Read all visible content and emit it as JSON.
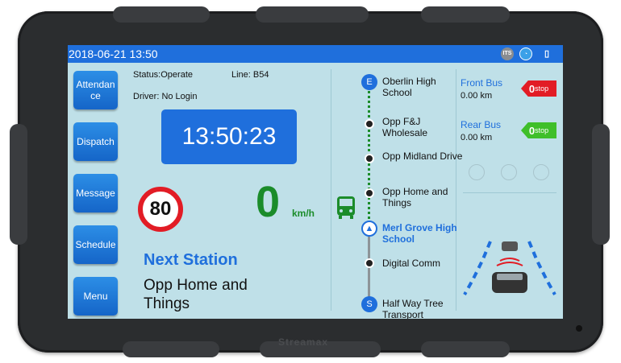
{
  "statusbar": {
    "datetime": "2018-06-21 13:50",
    "icons": [
      "its-icon",
      "signal-icon",
      "sim-icon"
    ],
    "its_label": "ITS"
  },
  "nav": {
    "items": [
      {
        "name": "attendance",
        "label": "Attendan ce"
      },
      {
        "name": "dispatch",
        "label": "Dispatch"
      },
      {
        "name": "message",
        "label": "Message"
      },
      {
        "name": "schedule",
        "label": "Schedule"
      },
      {
        "name": "menu",
        "label": "Menu"
      }
    ]
  },
  "info": {
    "status": "Status:Operate",
    "line": "Line: B54",
    "driver": "Driver: No Login"
  },
  "clock": "13:50:23",
  "speed": {
    "limit": "80",
    "current": "0",
    "unit": "km/h"
  },
  "next_station": {
    "label": "Next Station",
    "name": "Opp Home and Things"
  },
  "route": {
    "end_marker": "E",
    "start_marker": "S",
    "stops": [
      "Oberlin High School",
      "Opp F&J Wholesale",
      "Opp Midland Drive",
      "Opp Home and Things",
      "Merl Grove High School",
      "Digital Comm",
      "Half Way Tree Transport"
    ],
    "current_index": 4
  },
  "front_bus": {
    "title": "Front Bus",
    "distance": "0.00 km",
    "badge_value": "0",
    "badge_unit": "stop",
    "color": "#e21c25"
  },
  "rear_bus": {
    "title": "Rear Bus",
    "distance": "0.00 km",
    "badge_value": "0",
    "badge_unit": "stop",
    "color": "#3fbf2a"
  },
  "colors": {
    "accent": "#1f6fdc",
    "screen_bg": "#bfe0e8",
    "speed_green": "#1b8c2a"
  },
  "device_brand": "Streamax"
}
